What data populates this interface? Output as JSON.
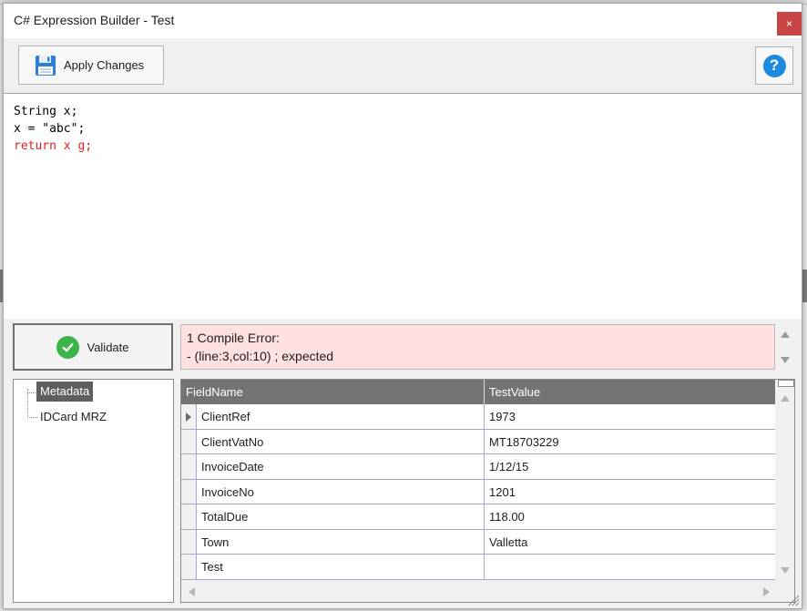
{
  "window": {
    "title": "C# Expression Builder - Test",
    "close_glyph": "×"
  },
  "toolbar": {
    "apply_label": "Apply Changes",
    "help_glyph": "?"
  },
  "editor": {
    "lines": [
      {
        "text": "String x;",
        "error": false
      },
      {
        "text": "x = \"abc\";",
        "error": false
      },
      {
        "text": "return x g;",
        "error": true
      }
    ]
  },
  "validate": {
    "label": "Validate"
  },
  "error_panel": {
    "line1": "1 Compile Error:",
    "line2": "- (line:3,col:10) ; expected"
  },
  "tree": {
    "root": "Metadata",
    "child": "IDCard MRZ"
  },
  "grid": {
    "columns": [
      "FieldName",
      "TestValue"
    ],
    "rows": [
      {
        "field": "ClientRef",
        "value": "1973"
      },
      {
        "field": "ClientVatNo",
        "value": "MT18703229"
      },
      {
        "field": "InvoiceDate",
        "value": "1/12/15"
      },
      {
        "field": "InvoiceNo",
        "value": "1201"
      },
      {
        "field": "TotalDue",
        "value": "118.00"
      },
      {
        "field": "Town",
        "value": "Valletta"
      },
      {
        "field": "Test",
        "value": ""
      }
    ]
  },
  "colors": {
    "error_text": "#e02020",
    "error_bg": "#ffe1e1",
    "accent_blue": "#1d8ae0",
    "success_green": "#3bb54a",
    "close_red": "#c94444"
  }
}
